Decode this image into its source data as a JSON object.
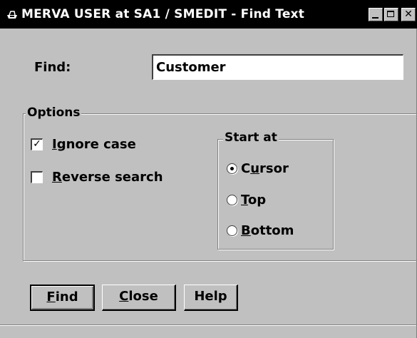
{
  "window": {
    "title": "MERVA USER at SA1 / SMEDIT - Find Text",
    "controls": {
      "minimize": "_",
      "maximize": "□",
      "close": "✕"
    }
  },
  "find": {
    "label": "Find:",
    "value": "Customer"
  },
  "options": {
    "legend": "Options",
    "ignore_case": {
      "label_hotkey": "I",
      "label_rest": "gnore case",
      "checked": true,
      "mark": "✓"
    },
    "reverse_search": {
      "label_hotkey": "R",
      "label_rest": "everse search",
      "checked": false,
      "mark": ""
    }
  },
  "start_at": {
    "legend": "Start at",
    "cursor": {
      "label_pre": "C",
      "label_hotkey": "u",
      "label_rest": "rsor",
      "selected": true
    },
    "top": {
      "label_pre": "",
      "label_hotkey": "T",
      "label_rest": "op",
      "selected": false
    },
    "bottom": {
      "label_pre": "",
      "label_hotkey": "B",
      "label_rest": "ottom",
      "selected": false
    }
  },
  "buttons": {
    "find": {
      "label_hotkey": "F",
      "label_rest": "ind"
    },
    "close": {
      "label_hotkey": "C",
      "label_rest": "lose"
    },
    "help": {
      "label": "Help"
    }
  },
  "icons": {
    "window_icon": "window-app-icon"
  }
}
